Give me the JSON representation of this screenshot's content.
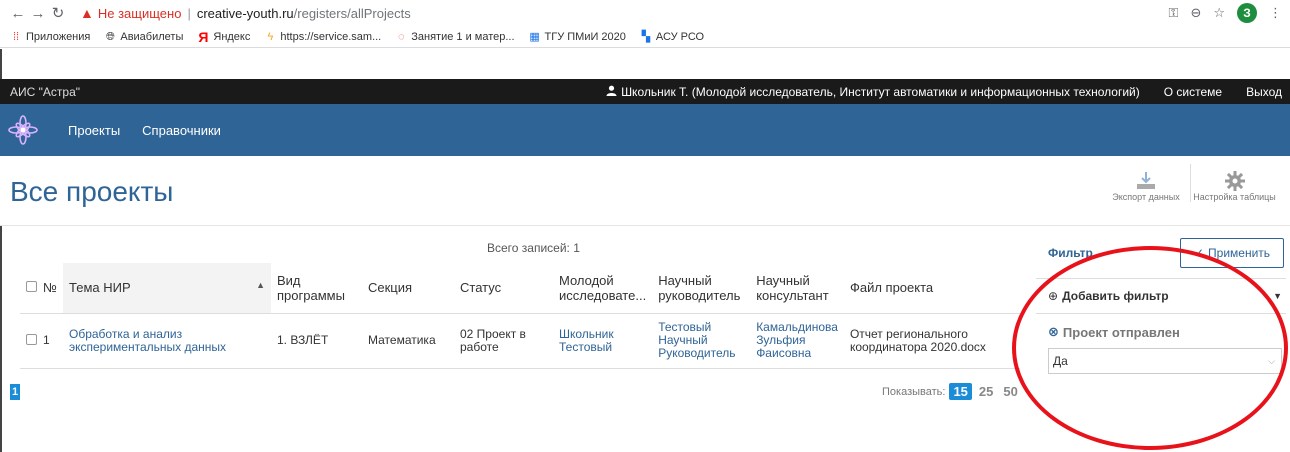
{
  "browser": {
    "insecure_label": "Не защищено",
    "url_host": "creative-youth.ru",
    "url_path": "/registers/allProjects",
    "profile_letter": "З",
    "bookmarks": [
      {
        "label": "Приложения",
        "icon": "apps-grid-icon"
      },
      {
        "label": "Авиабилеты",
        "icon": "globe-icon"
      },
      {
        "label": "Яндекс",
        "icon": "yandex-icon"
      },
      {
        "label": "https://service.sam...",
        "icon": "lightning-icon"
      },
      {
        "label": "Занятие 1 и матер...",
        "icon": "circle-icon"
      },
      {
        "label": "ТГУ ПМиИ 2020",
        "icon": "calendar-icon"
      },
      {
        "label": "АСУ РСО",
        "icon": "blocks-icon"
      }
    ]
  },
  "app": {
    "brand": "АИС \"Астра\"",
    "user": "Школьник Т. (Молодой исследователь, Институт автоматики и информационных технологий)",
    "about": "О системе",
    "logout": "Выход",
    "nav": [
      "Проекты",
      "Справочники"
    ]
  },
  "page": {
    "title": "Все проекты",
    "export_label": "Экспорт данных",
    "settings_label": "Настройка таблицы",
    "total": "Всего записей: 1"
  },
  "table": {
    "columns": [
      "№",
      "Тема НИР",
      "Вид программы",
      "Секция",
      "Статус",
      "Молодой исследовате...",
      "Научный руководитель",
      "Научный консультант",
      "Файл проекта"
    ],
    "rows": [
      {
        "num": "1",
        "topic": "Обработка и анализ экспериментальных данных",
        "program": "1. ВЗЛЁТ",
        "section": "Математика",
        "status": "02 Проект в работе",
        "researcher": "Школьник Тестовый",
        "supervisor": "Тестовый Научный Руководитель",
        "consultant": "Камальдинова Зульфия Фаисовна",
        "file": "Отчет регионального координатора 2020.docx"
      }
    ]
  },
  "pager": {
    "current": "1",
    "show_label": "Показывать:",
    "sizes": [
      "15",
      "25",
      "50"
    ]
  },
  "filter": {
    "title": "Фильтр",
    "apply": "Применить",
    "add": "Добавить фильтр",
    "field_name": "Проект отправлен",
    "field_value": "Да"
  },
  "colors": {
    "brand_blue": "#2f6496",
    "annotation_red": "#e8121b"
  }
}
